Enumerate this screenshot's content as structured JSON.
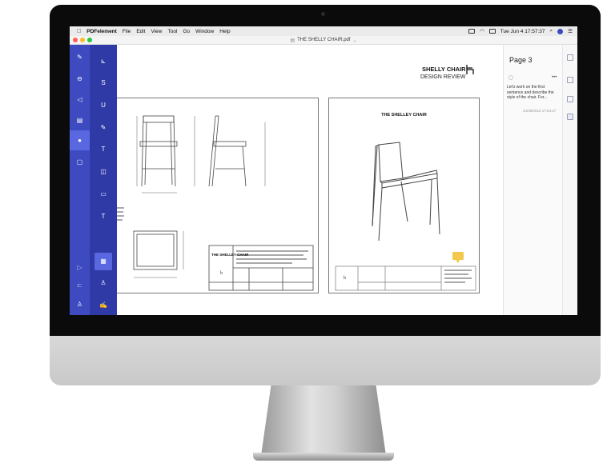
{
  "menubar": {
    "apple": "",
    "app_name": "PDFelement",
    "items": [
      "File",
      "Edit",
      "View",
      "Tool",
      "Go",
      "Window",
      "Help"
    ],
    "clock": "Tue Jun 4  17:57:37"
  },
  "window": {
    "title": "THE SHELLY CHAIR.pdf"
  },
  "document": {
    "header_title": "SHELLY CHAIR",
    "header_subtitle": "DESIGN REVIEW",
    "sheet2_title": "THE SHELLEY CHAIR",
    "titleblock_title": "THE SHELLEY CHAIR"
  },
  "panel": {
    "page_label": "Page 3",
    "more": "•••",
    "comment": "Let's work on the first sentence and describe the style of the chair. For...",
    "date": "24/08/2018 17:54:37"
  },
  "colors": {
    "rail": "#3e4bc0",
    "tools": "#2f3aa7",
    "selected": "#5968e0",
    "sticky_note": "#f2c94c"
  },
  "icons": {
    "rail": [
      "edit-icon",
      "stamp-icon",
      "send-icon",
      "bookmark-icon",
      "comment-icon",
      "form-icon",
      "collapse-icon",
      "arrow-icon",
      "user-icon"
    ],
    "tools": [
      "highlight-icon",
      "strikethrough-icon",
      "underline-icon",
      "pencil-icon",
      "textbox-icon",
      "text-comment-icon",
      "area-icon",
      "text-icon",
      "sticky-note-icon",
      "stamp-icon",
      "signature-icon"
    ]
  }
}
